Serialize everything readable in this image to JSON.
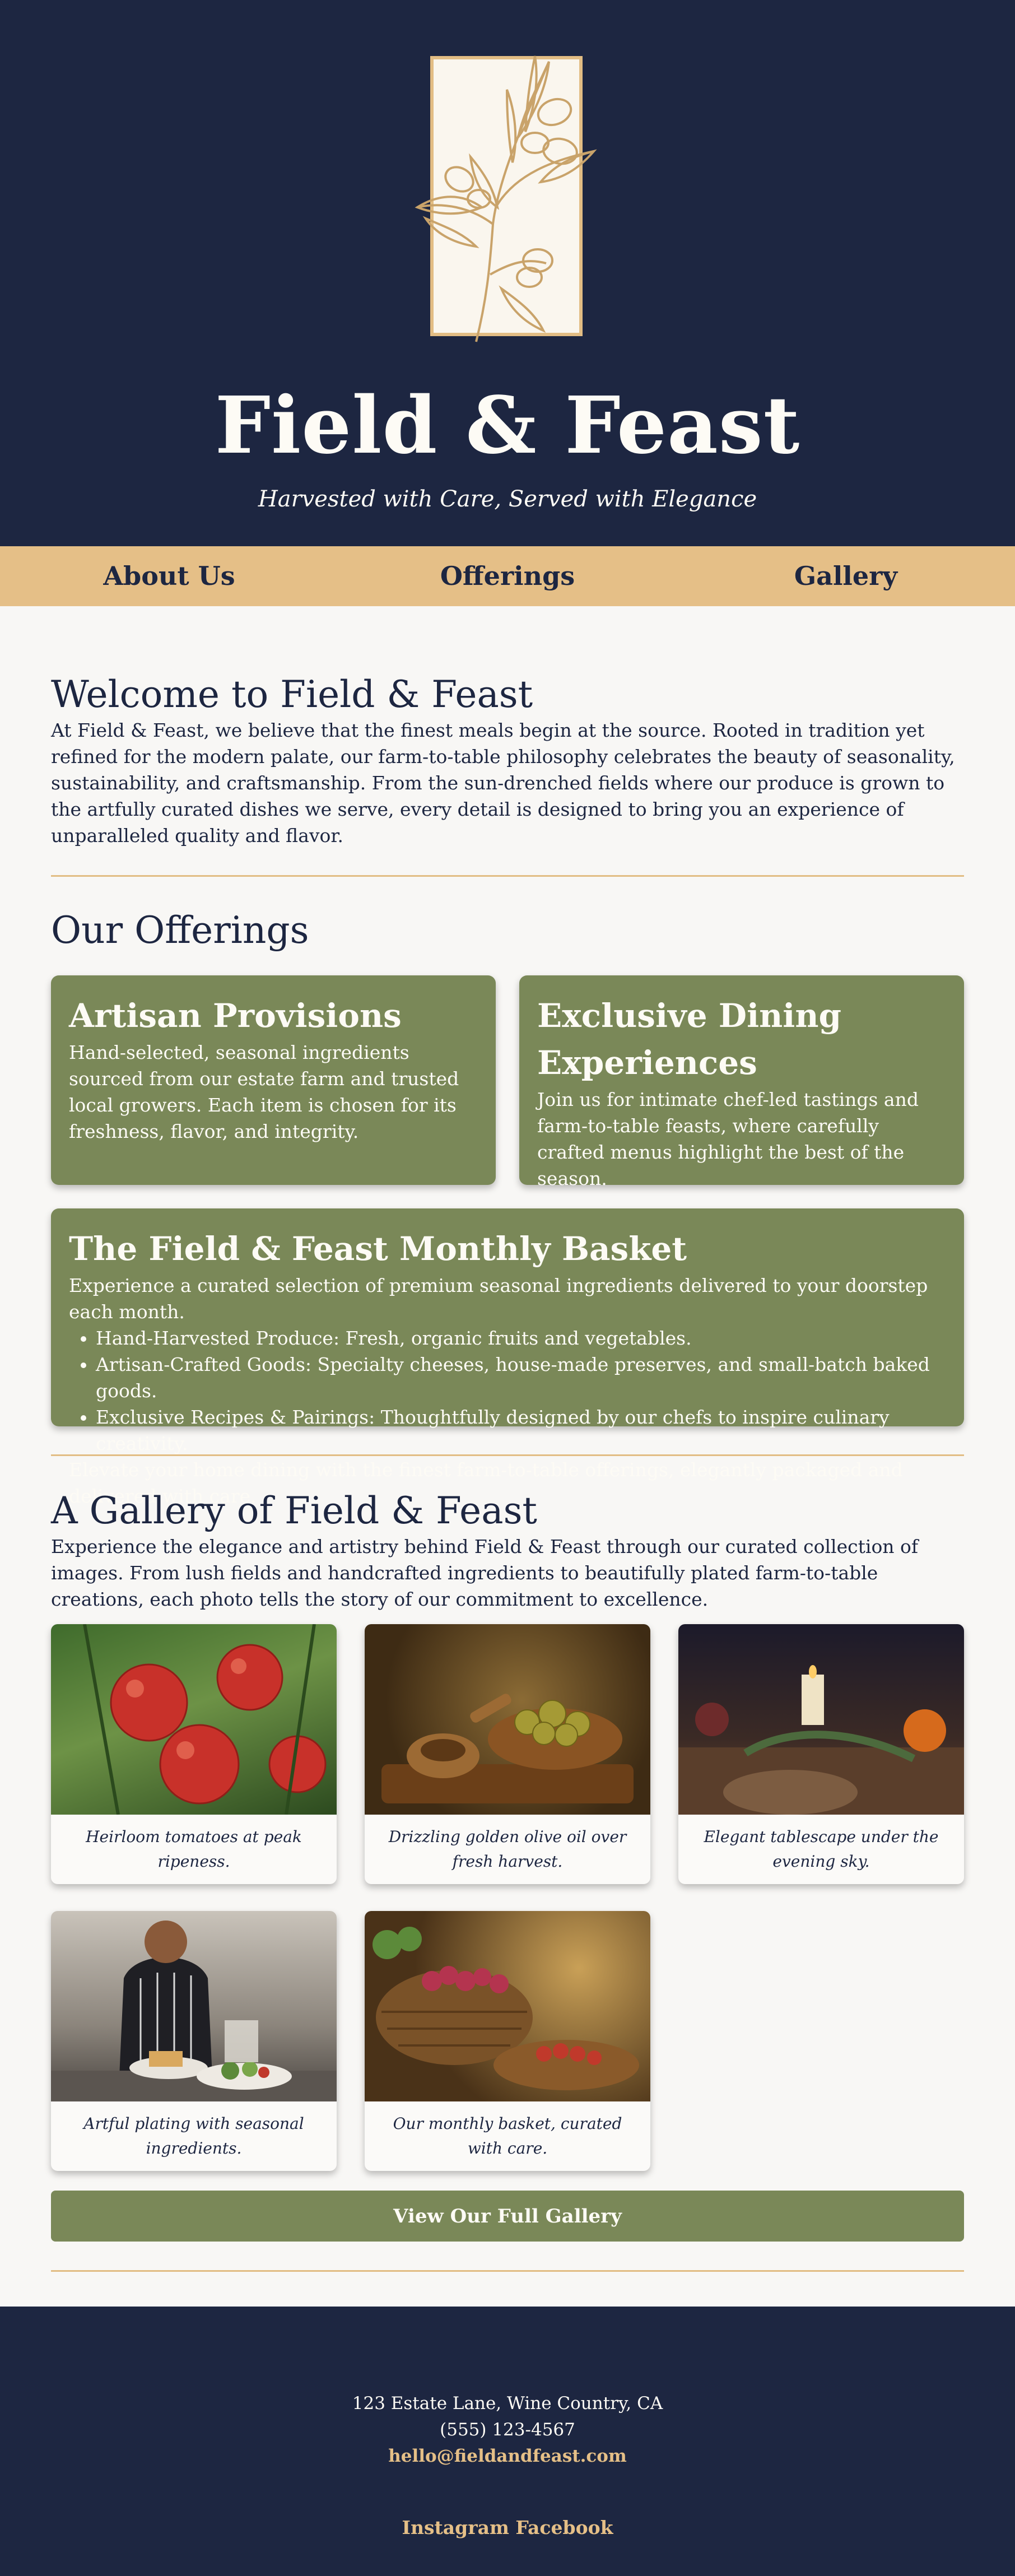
{
  "hero": {
    "title": "Field & Feast",
    "tagline": "Harvested with Care, Served with Elegance"
  },
  "nav": {
    "items": [
      "About Us",
      "Offerings",
      "Gallery"
    ]
  },
  "about": {
    "heading": "Welcome to Field & Feast",
    "text": "At Field & Feast, we believe that the finest meals begin at the source. Rooted in tradition yet refined for the modern palate, our farm-to-table philosophy celebrates the beauty of seasonality, sustainability, and craftsmanship. From the sun-drenched fields where our produce is grown to the artfully curated dishes we serve, every detail is designed to bring you an experience of unparalleled quality and flavor."
  },
  "offerings": {
    "heading": "Our Offerings",
    "cards": [
      {
        "title": "Artisan Provisions",
        "text": "Hand-selected, seasonal ingredients sourced from our estate farm and trusted local growers. Each item is chosen for its freshness, flavor, and integrity."
      },
      {
        "title": "Exclusive Dining Experiences",
        "text": "Join us for intimate chef-led tastings and farm-to-table feasts, where carefully crafted menus highlight the best of the season."
      }
    ],
    "basket": {
      "title": "The Field & Feast Monthly Basket",
      "intro": "Experience a curated selection of premium seasonal ingredients delivered to your doorstep each month.",
      "items": [
        "Hand-Harvested Produce: Fresh, organic fruits and vegetables.",
        "Artisan-Crafted Goods: Specialty cheeses, house-made preserves, and small-batch baked goods.",
        "Exclusive Recipes & Pairings: Thoughtfully designed by our chefs to inspire culinary creativity."
      ],
      "outro": "Elevate your home dining with the finest farm-to-table offerings, elegantly packaged and delivered with care."
    }
  },
  "gallery": {
    "heading": "A Gallery of Field & Feast",
    "text": "Experience the elegance and artistry behind Field & Feast through our curated collection of images. From lush fields and handcrafted ingredients to beautifully plated farm-to-table creations, each photo tells the story of our commitment to excellence.",
    "items": [
      {
        "caption": "Heirloom tomatoes at peak ripeness."
      },
      {
        "caption": "Drizzling golden olive oil over fresh harvest."
      },
      {
        "caption": "Elegant tablescape under the evening sky."
      },
      {
        "caption": "Artful plating with seasonal ingredients."
      },
      {
        "caption": "Our monthly basket, curated with care."
      }
    ],
    "button_label": "View Our Full Gallery"
  },
  "footer": {
    "address": "123 Estate Lane, Wine Country, CA",
    "phone": "(555) 123-4567",
    "email": "hello@fieldandfeast.com",
    "social": [
      "Instagram",
      "Facebook"
    ]
  },
  "colors": {
    "navy": "#1d2641",
    "gold": "#e5bf87",
    "olive": "#7a8858",
    "cream": "#f8f7f5"
  }
}
